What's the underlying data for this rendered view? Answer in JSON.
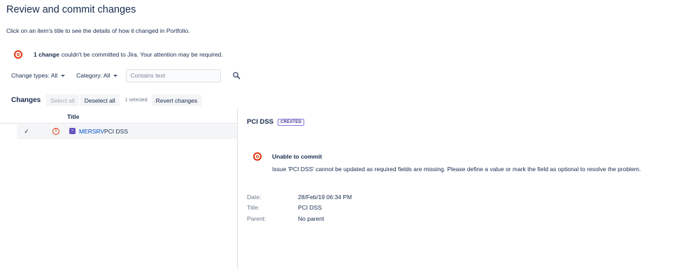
{
  "page": {
    "title": "Review and commit changes",
    "intro": "Click on an item's title to see the details of how it changed in Portfolio."
  },
  "warning": {
    "count_text": "1 change",
    "message": "couldn't be committed to Jira. Your attention may be required."
  },
  "filters": {
    "change_types": "Change types: All",
    "category": "Category: All",
    "text_placeholder": "Contains text",
    "text_value": ""
  },
  "toolbar": {
    "label": "Changes",
    "select_all": "Select all",
    "deselect_all": "Deselect all",
    "selected_count": "1 selected",
    "revert": "Revert changes"
  },
  "list": {
    "column_title": "Title",
    "rows": [
      {
        "checked": "✓",
        "issue_type_glyph": "⌁",
        "key": "MERSRV",
        "title": "PCI DSS"
      }
    ]
  },
  "detail": {
    "title": "PCI DSS",
    "status_lozenge": "CREATED",
    "error_heading": "Unable to commit",
    "error_message": "Issue 'PCI DSS' cannot be updated as required fields are missing. Please define a value or mark the field as optional to resolve the problem.",
    "fields": [
      {
        "label": "Date:",
        "value": "28/Feb/19 06:34 PM"
      },
      {
        "label": "Title:",
        "value": "PCI DSS"
      },
      {
        "label": "Parent:",
        "value": "No parent"
      }
    ]
  },
  "colors": {
    "error": "#de350b",
    "link": "#0052cc",
    "lozenge": "#403294",
    "issue_type": "#6554c0"
  }
}
